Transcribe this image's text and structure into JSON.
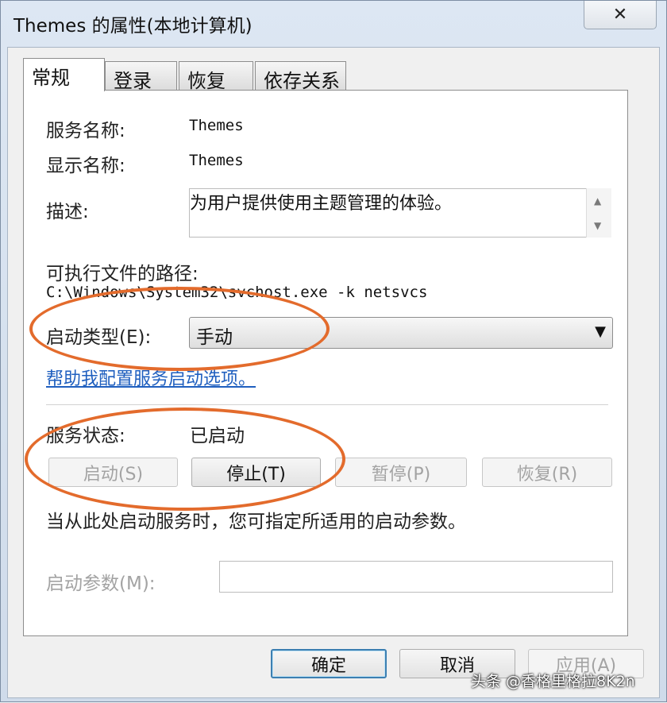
{
  "window": {
    "title": "Themes 的属性(本地计算机)",
    "close_symbol": "✕"
  },
  "tabs": [
    {
      "label": "常规"
    },
    {
      "label": "登录"
    },
    {
      "label": "恢复"
    },
    {
      "label": "依存关系"
    }
  ],
  "general": {
    "service_name_label": "服务名称:",
    "service_name_value": "Themes",
    "display_name_label": "显示名称:",
    "display_name_value": "Themes",
    "description_label": "描述:",
    "description_value": "为用户提供使用主题管理的体验。",
    "scroll_up": "▲",
    "scroll_down": "▼",
    "path_label": "可执行文件的路径:",
    "path_value": "C:\\Windows\\System32\\svchost.exe -k netsvcs",
    "startup_type_label": "启动类型(E):",
    "startup_type_value": "手动",
    "dropdown_arrow": "▼",
    "help_link": "帮助我配置服务启动选项。",
    "status_label": "服务状态:",
    "status_value": "已启动",
    "buttons": {
      "start": "启动(S)",
      "stop": "停止(T)",
      "pause": "暂停(P)",
      "resume": "恢复(R)"
    },
    "hint": "当从此处启动服务时，您可指定所适用的启动参数。",
    "start_params_label": "启动参数(M):",
    "start_params_value": ""
  },
  "footer": {
    "ok": "确定",
    "cancel": "取消",
    "apply": "应用(A)"
  },
  "watermark": "头条 @香格里格拉8K2n",
  "colors": {
    "annotation": "#e36b2c",
    "link": "#1f5fbf"
  }
}
